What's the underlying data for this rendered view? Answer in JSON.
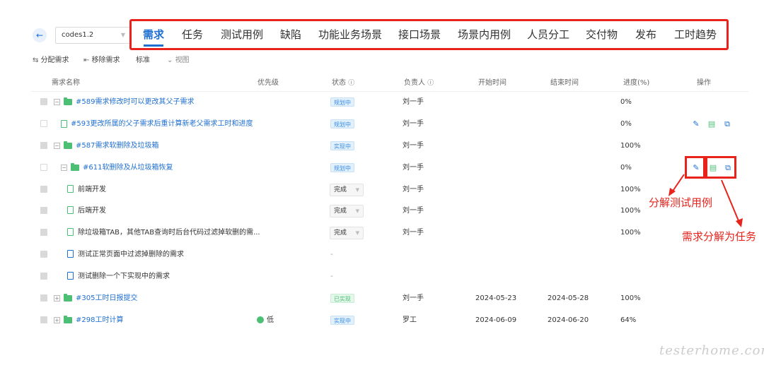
{
  "header": {
    "back_icon": "arrow-left-icon",
    "project_select": "codes1.2",
    "tabs": [
      "需求",
      "任务",
      "测试用例",
      "缺陷",
      "功能业务场景",
      "接口场景",
      "场景内用例",
      "人员分工",
      "交付物",
      "发布",
      "工时趋势"
    ],
    "active_tab": 0
  },
  "toolbar": {
    "assign_label": "分配需求",
    "remove_label": "移除需求",
    "standard_label": "标准",
    "view_label": "视图"
  },
  "table": {
    "columns": [
      "需求名称",
      "优先级",
      "状态",
      "负责人",
      "开始时间",
      "结束时间",
      "进度(%)",
      "操作"
    ],
    "rows": [
      {
        "name": "#589需求修改时可以更改其父子需求",
        "status": "规划中",
        "owner": "刘一手",
        "start": "",
        "end": "",
        "progress": "0%",
        "priority": ""
      },
      {
        "name": "#593更改所属的父子需求后重计算新老父需求工时和进度",
        "status": "规划中",
        "owner": "刘一手",
        "start": "",
        "end": "",
        "progress": "0%",
        "priority": ""
      },
      {
        "name": "#587需求软删除及垃圾箱",
        "status": "实现中",
        "owner": "刘一手",
        "start": "",
        "end": "",
        "progress": "100%",
        "priority": ""
      },
      {
        "name": "#611软删除及从垃圾箱恢复",
        "status": "规划中",
        "owner": "刘一手",
        "start": "",
        "end": "",
        "progress": "0%",
        "priority": ""
      },
      {
        "name": "前端开发",
        "status": "完成",
        "owner": "刘一手",
        "start": "",
        "end": "",
        "progress": "100%",
        "priority": ""
      },
      {
        "name": "后端开发",
        "status": "完成",
        "owner": "刘一手",
        "start": "",
        "end": "",
        "progress": "100%",
        "priority": ""
      },
      {
        "name": "除垃圾箱TAB，其他TAB查询时后台代码过滤掉软删的需...",
        "status": "完成",
        "owner": "刘一手",
        "start": "",
        "end": "",
        "progress": "100%",
        "priority": ""
      },
      {
        "name": "测试正常页面中过滤掉删除的需求",
        "status": "-",
        "owner": "",
        "start": "",
        "end": "",
        "progress": "",
        "priority": ""
      },
      {
        "name": "测试删除一个下实现中的需求",
        "status": "-",
        "owner": "",
        "start": "",
        "end": "",
        "progress": "",
        "priority": ""
      },
      {
        "name": "#305工时日报提交",
        "status": "已实现",
        "owner": "刘一手",
        "start": "2024-05-23",
        "end": "2024-05-28",
        "progress": "100%",
        "priority": ""
      },
      {
        "name": "#298工时计算",
        "status": "实现中",
        "owner": "罗工",
        "start": "2024-06-09",
        "end": "2024-06-20",
        "progress": "64%",
        "priority": "低"
      }
    ]
  },
  "annotations": {
    "split_test": "分解测试用例",
    "split_task": "需求分解为任务"
  },
  "watermark": "testerhome.com",
  "colors": {
    "accent": "#1f6fd1",
    "annotation": "#e8231c",
    "folder": "#4cbf75"
  }
}
